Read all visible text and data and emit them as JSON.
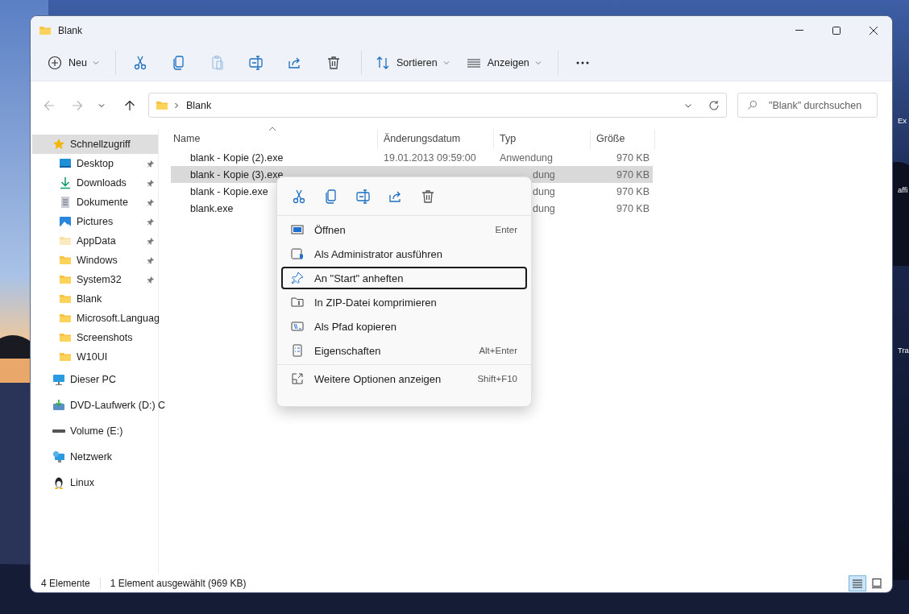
{
  "window": {
    "title": "Blank"
  },
  "toolbar": {
    "groups": [
      [
        {
          "kind": "new",
          "label": "Neu",
          "disabled": false
        }
      ],
      [
        {
          "kind": "cut",
          "disabled": false
        },
        {
          "kind": "copy",
          "disabled": false
        },
        {
          "kind": "paste",
          "disabled": true
        },
        {
          "kind": "rename",
          "disabled": false
        },
        {
          "kind": "share",
          "disabled": false
        },
        {
          "kind": "delete",
          "disabled": false
        }
      ],
      [
        {
          "kind": "sort",
          "label": "Sortieren",
          "disabled": false
        },
        {
          "kind": "view",
          "label": "Anzeigen",
          "disabled": false
        }
      ],
      [
        {
          "kind": "more",
          "disabled": false
        }
      ]
    ]
  },
  "navigation": [
    {
      "kind": "back",
      "disabled": true
    },
    {
      "kind": "forward",
      "disabled": true
    },
    {
      "kind": "recent",
      "disabled": false
    },
    {
      "kind": "up",
      "disabled": false
    }
  ],
  "address": {
    "path": "Blank",
    "search_placeholder": "\"Blank\" durchsuchen"
  },
  "sidebar": {
    "items": [
      {
        "label": "Schnellzugriff",
        "kind": "star",
        "selected": true,
        "children": [
          {
            "label": "Desktop",
            "kind": "desktop",
            "pinned": true,
            "selected": false
          },
          {
            "label": "Downloads",
            "kind": "download",
            "pinned": true,
            "selected": false
          },
          {
            "label": "Dokumente",
            "kind": "document",
            "pinned": true,
            "selected": false
          },
          {
            "label": "Pictures",
            "kind": "pictures",
            "pinned": true,
            "selected": false
          },
          {
            "label": "AppData",
            "kind": "folder-light",
            "pinned": true,
            "selected": false
          },
          {
            "label": "Windows",
            "kind": "folder",
            "pinned": true,
            "selected": false
          },
          {
            "label": "System32",
            "kind": "folder",
            "pinned": true,
            "selected": false
          },
          {
            "label": "Blank",
            "kind": "folder",
            "pinned": false,
            "selected": false
          },
          {
            "label": "Microsoft.Languag",
            "kind": "folder",
            "pinned": false,
            "selected": false
          },
          {
            "label": "Screenshots",
            "kind": "folder",
            "pinned": false,
            "selected": false
          },
          {
            "label": "W10UI",
            "kind": "folder",
            "pinned": false,
            "selected": false
          }
        ]
      },
      {
        "label": "Dieser PC",
        "kind": "pc",
        "selected": false
      },
      {
        "label": "DVD-Laufwerk (D:) C",
        "kind": "dvd",
        "selected": false
      },
      {
        "label": "Volume (E:)",
        "kind": "drive",
        "selected": false
      },
      {
        "label": "Netzwerk",
        "kind": "network",
        "selected": false
      },
      {
        "label": "Linux",
        "kind": "penguin",
        "selected": false
      }
    ]
  },
  "file_list": {
    "columns": [
      "Name",
      "Änderungsdatum",
      "Typ",
      "Größe"
    ],
    "rows": [
      {
        "name": "blank - Kopie (2).exe",
        "date": "19.01.2013 09:59:00",
        "type": "Anwendung",
        "size": "970 KB",
        "selected": false
      },
      {
        "name": "blank - Kopie (3).exe",
        "type": "dung",
        "size": "970 KB",
        "selected": true
      },
      {
        "name": "blank - Kopie.exe",
        "type": "dung",
        "size": "970 KB",
        "selected": false
      },
      {
        "name": "blank.exe",
        "type": "dung",
        "size": "970 KB",
        "selected": false
      }
    ]
  },
  "context_menu": {
    "quick_actions": [
      {
        "kind": "cut"
      },
      {
        "kind": "copy"
      },
      {
        "kind": "rename"
      },
      {
        "kind": "share"
      },
      {
        "kind": "delete"
      }
    ],
    "items": [
      {
        "kind": "open",
        "label": "Öffnen",
        "shortcut": "Enter",
        "focused": false
      },
      {
        "kind": "admin",
        "label": "Als Administrator ausführen",
        "focused": false
      },
      {
        "kind": "pin",
        "label": "An \"Start\" anheften",
        "focused": true
      },
      {
        "kind": "zip",
        "label": "In ZIP-Datei komprimieren",
        "focused": false
      },
      {
        "kind": "path",
        "label": "Als Pfad kopieren",
        "focused": false
      },
      {
        "kind": "properties",
        "label": "Eigenschaften",
        "shortcut": "Alt+Enter",
        "focused": false
      }
    ],
    "footer_items": [
      {
        "kind": "more-options",
        "label": "Weitere Optionen anzeigen",
        "shortcut": "Shift+F10",
        "focused": false
      }
    ]
  },
  "status_bar": {
    "count": "4 Elemente",
    "selection": "1 Element ausgewählt (969 KB)",
    "views": [
      {
        "kind": "details",
        "selected": true
      },
      {
        "kind": "tiles",
        "selected": false
      }
    ]
  },
  "desktop_labels": [
    "Ex",
    "affi",
    "Tra"
  ]
}
